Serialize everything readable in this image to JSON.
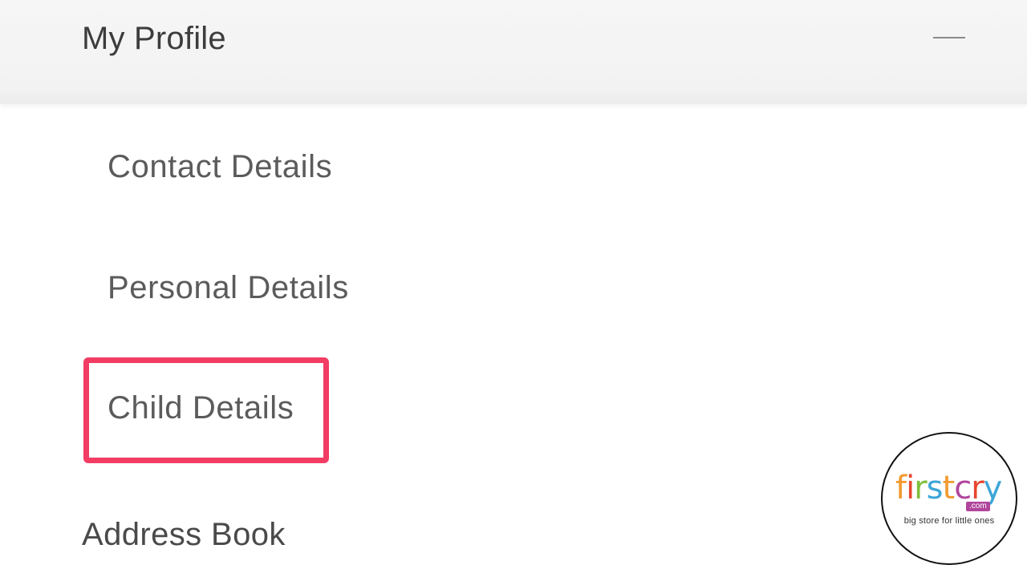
{
  "header": {
    "title": "My Profile",
    "collapse_icon": "minus-icon"
  },
  "menu": {
    "items": [
      {
        "label": "Contact Details"
      },
      {
        "label": "Personal Details"
      },
      {
        "label": "Child Details",
        "highlighted": true
      }
    ]
  },
  "next_section": {
    "label": "Address Book"
  },
  "logo": {
    "letters": [
      "f",
      "i",
      "r",
      "s",
      "t",
      "c",
      "r",
      "y"
    ],
    "letter_colors": [
      "#f29a2e",
      "#e8462f",
      "#7fbf3a",
      "#3ea6d8",
      "#f29a2e",
      "#b0459c",
      "#e8462f",
      "#3ea6d8"
    ],
    "domain": ".com",
    "tagline": "big store for little ones"
  },
  "colors": {
    "highlight": "#f23c64",
    "header_bg": "#f4f4f4",
    "text": "#5b5b5b"
  }
}
